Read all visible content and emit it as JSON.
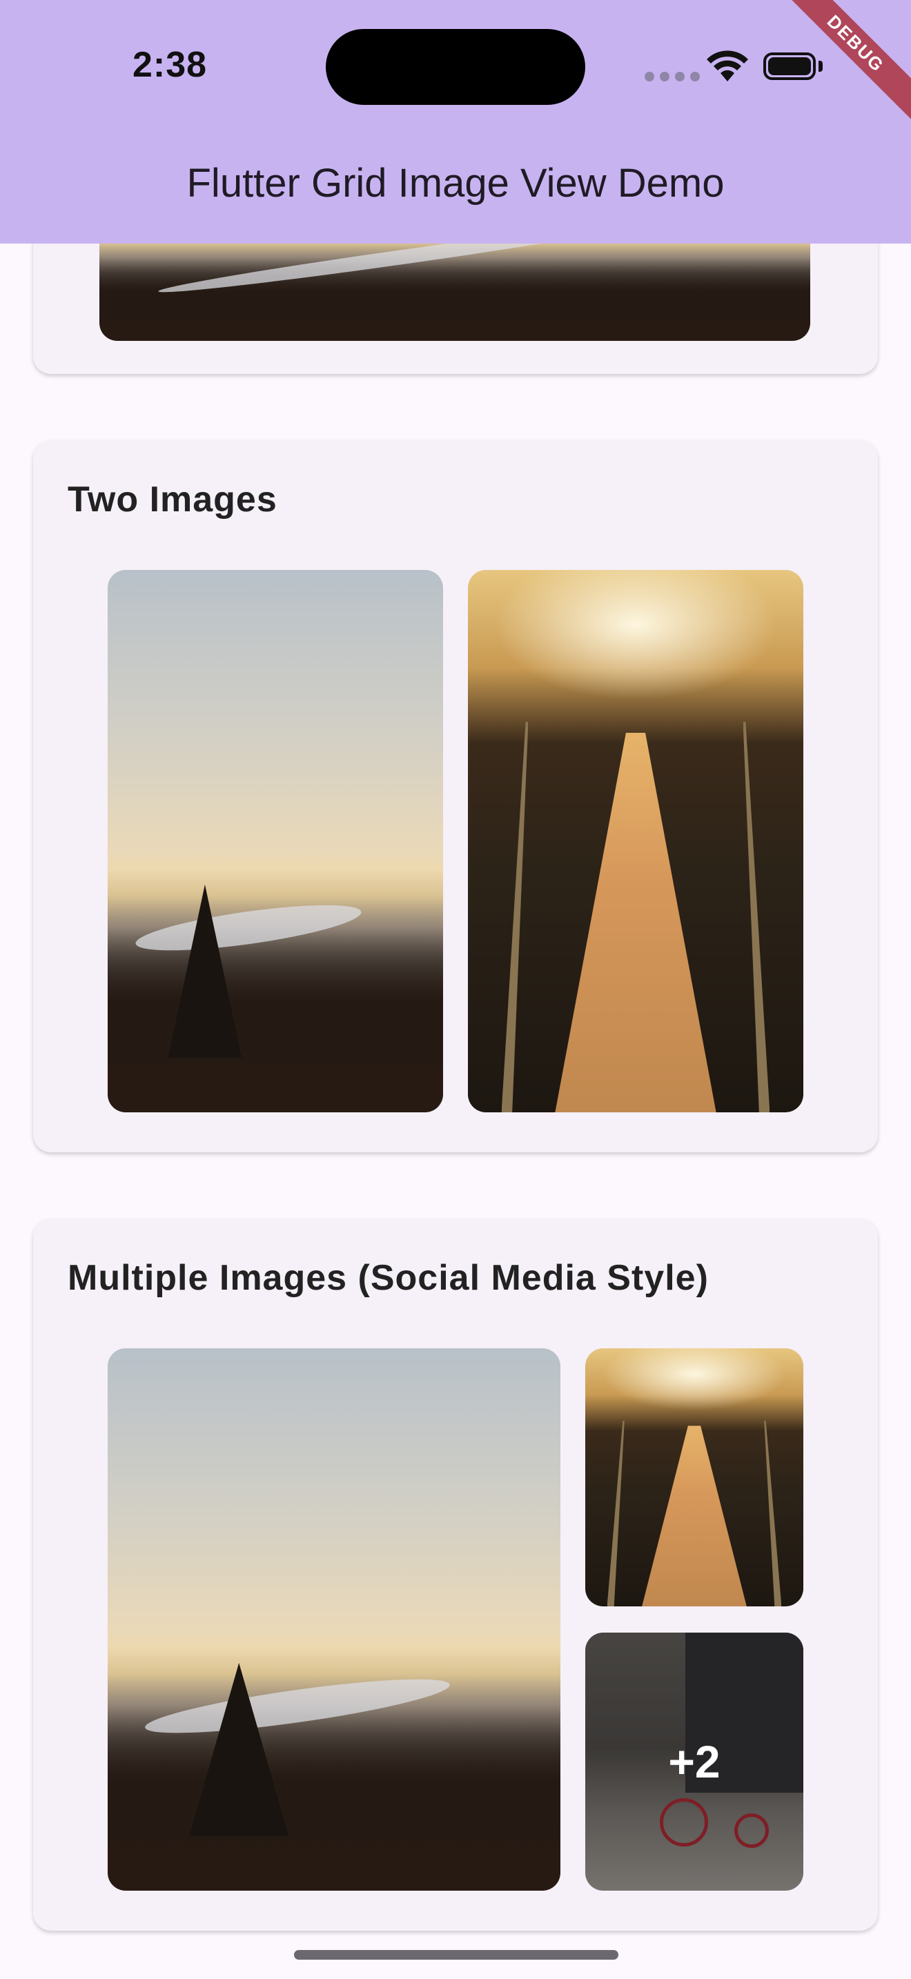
{
  "status_bar": {
    "time": "2:38"
  },
  "debug_banner": "DEBUG",
  "app_bar": {
    "title": "Flutter Grid Image View Demo"
  },
  "sections": [
    {
      "title": ""
    },
    {
      "title": "Two Images"
    },
    {
      "title": "Multiple Images (Social Media Style)",
      "more_count": "+2"
    }
  ],
  "colors": {
    "app_bar": "#c8b3f1",
    "background": "#fdf7fe",
    "card": "#f6f0f8"
  },
  "icons": [
    "wifi-icon",
    "battery-icon",
    "signal-icon"
  ]
}
